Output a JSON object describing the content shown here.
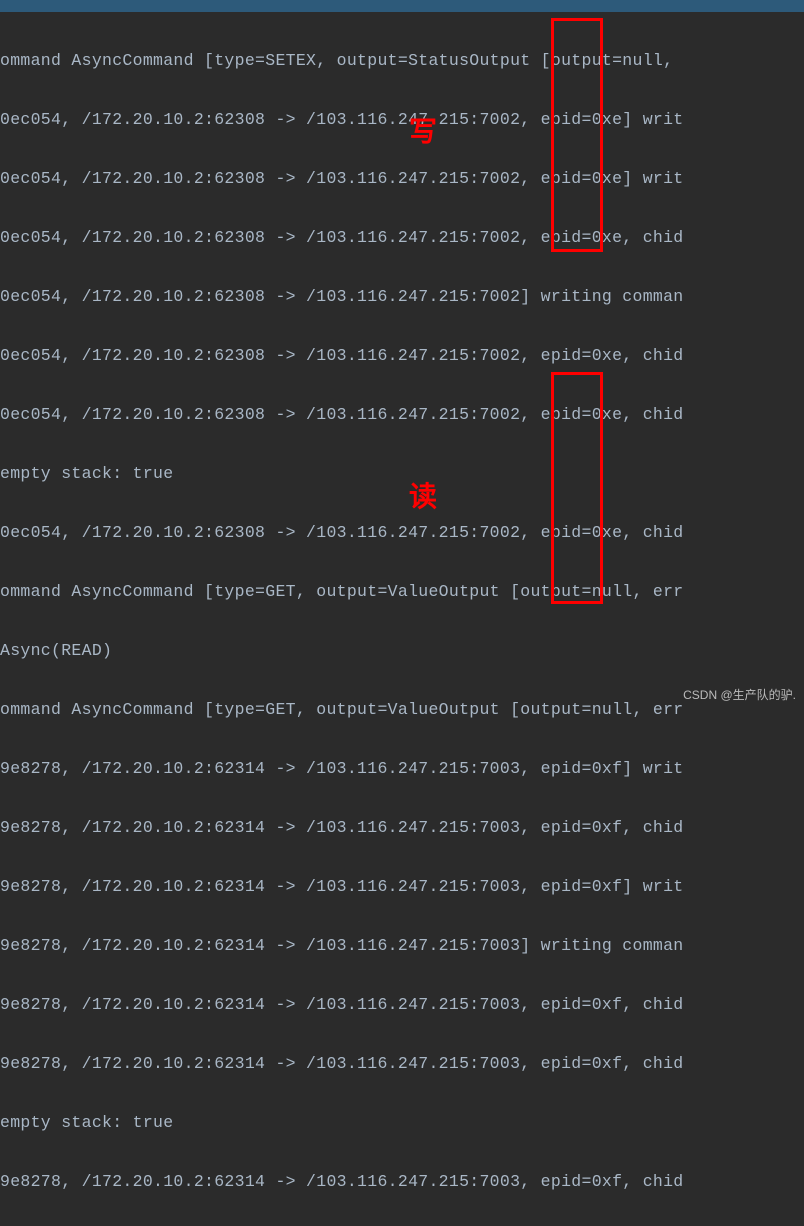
{
  "console": {
    "lines": [
      "ommand AsyncCommand [type=SETEX, output=StatusOutput [output=null, ",
      "0ec054, /172.20.10.2:62308 -> /103.116.247.215:7002, epid=0xe] writ",
      "0ec054, /172.20.10.2:62308 -> /103.116.247.215:7002, epid=0xe] writ",
      "0ec054, /172.20.10.2:62308 -> /103.116.247.215:7002, epid=0xe, chid",
      "0ec054, /172.20.10.2:62308 -> /103.116.247.215:7002] writing comman",
      "0ec054, /172.20.10.2:62308 -> /103.116.247.215:7002, epid=0xe, chid",
      "0ec054, /172.20.10.2:62308 -> /103.116.247.215:7002, epid=0xe, chid",
      "empty stack: true",
      "0ec054, /172.20.10.2:62308 -> /103.116.247.215:7002, epid=0xe, chid",
      "ommand AsyncCommand [type=GET, output=ValueOutput [output=null, err",
      "Async(READ)",
      "ommand AsyncCommand [type=GET, output=ValueOutput [output=null, err",
      "9e8278, /172.20.10.2:62314 -> /103.116.247.215:7003, epid=0xf] writ",
      "9e8278, /172.20.10.2:62314 -> /103.116.247.215:7003, epid=0xf, chid",
      "9e8278, /172.20.10.2:62314 -> /103.116.247.215:7003, epid=0xf] writ",
      "9e8278, /172.20.10.2:62314 -> /103.116.247.215:7003] writing comman",
      "9e8278, /172.20.10.2:62314 -> /103.116.247.215:7003, epid=0xf, chid",
      "9e8278, /172.20.10.2:62314 -> /103.116.247.215:7003, epid=0xf, chid",
      "empty stack: true",
      "9e8278, /172.20.10.2:62314 -> /103.116.247.215:7003, epid=0xf, chid"
    ]
  },
  "annotations": {
    "label1": "写",
    "label2": "读"
  },
  "watermark": "CSDN @生产队的驴."
}
